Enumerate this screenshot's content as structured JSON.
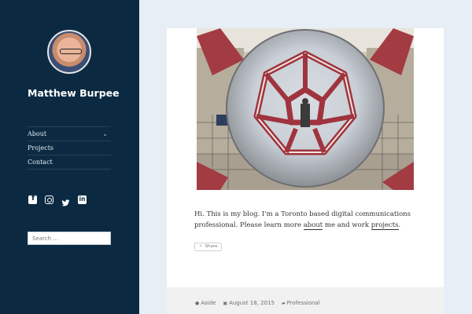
{
  "site": {
    "title": "Matthew Burpee"
  },
  "nav": {
    "items": [
      {
        "label": "About",
        "has_submenu": true
      },
      {
        "label": "Projects"
      },
      {
        "label": "Contact"
      }
    ],
    "submenu_icon": "chevron-down-icon"
  },
  "social": [
    "facebook-icon",
    "instagram-icon",
    "twitter-icon",
    "linkedin-icon"
  ],
  "search": {
    "placeholder": "Search …"
  },
  "post": {
    "image_alt": "Photo of a mirrored geometric sculpture in a courtyard",
    "text_before": "Hi. This is my blog. I'm a Toronto based digital communications professional. Please learn more ",
    "link_about": "about",
    "text_middle": " me and work ",
    "link_projects": "projects",
    "text_after": ".",
    "share_label": "Share"
  },
  "meta": {
    "format": "Aside",
    "date": "August 18, 2015",
    "category": "Professional"
  },
  "colors": {
    "sidebar": "#0b2a42",
    "page_background": "#e8eef6",
    "card": "#ffffff",
    "footer": "#f1f1f1"
  }
}
